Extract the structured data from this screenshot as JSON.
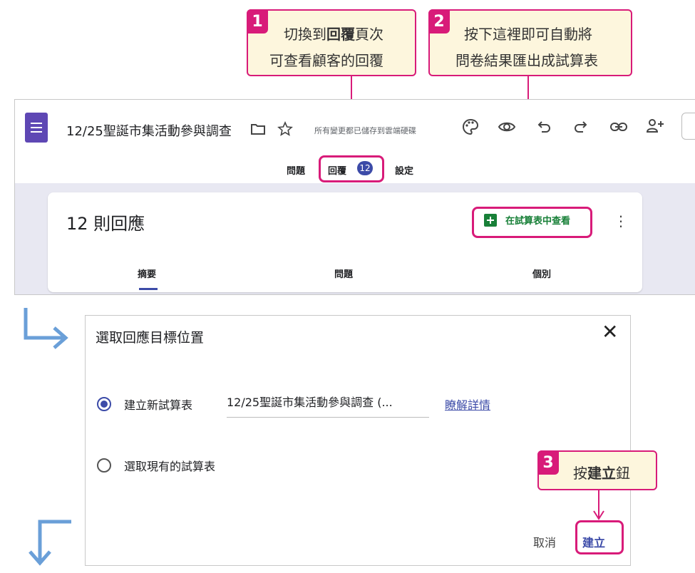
{
  "callouts": {
    "c1": {
      "num": "1",
      "l1a": "切換到",
      "l1b": "回覆",
      "l1c": "頁次",
      "l2": "可查看顧客的回覆"
    },
    "c2": {
      "num": "2",
      "l1": "按下這裡即可自動將",
      "l2": "問卷結果匯出成試算表"
    },
    "c3": {
      "num": "3",
      "a": "按",
      "b": "建立",
      "c": "鈕"
    }
  },
  "form": {
    "title": "12/25聖誕市集活動參與調查",
    "save_status": "所有變更都已儲存到雲端硬碟",
    "tabs": {
      "questions": "問題",
      "responses": "回覆",
      "responses_count": "12",
      "settings": "設定"
    },
    "responses_title": "12 則回應",
    "view_in_sheets": "在試算表中查看",
    "subtabs": {
      "summary": "摘要",
      "question": "問題",
      "individual": "個別"
    }
  },
  "dialog": {
    "title": "選取回應目標位置",
    "option_new": "建立新試算表",
    "new_sheet_name": "12/25聖誕市集活動參與調查 (...",
    "learn_more": "瞭解詳情",
    "option_existing": "選取現有的試算表",
    "cancel": "取消",
    "create": "建立"
  },
  "icons": {
    "folder": "folder-icon",
    "star": "star-icon",
    "palette": "palette-icon",
    "preview": "eye-icon",
    "undo": "undo-icon",
    "redo": "redo-icon",
    "link": "link-icon",
    "add_person": "add-person-icon",
    "more": "more-vert-icon",
    "close": "close-icon"
  },
  "colors": {
    "accent": "#d81b79",
    "callout_bg": "#fdf6dd",
    "forms_purple": "#5e47b4",
    "sheets_green": "#188038",
    "primary_blue": "#3c4ba8",
    "flow_arrow": "#6a9fd8"
  }
}
